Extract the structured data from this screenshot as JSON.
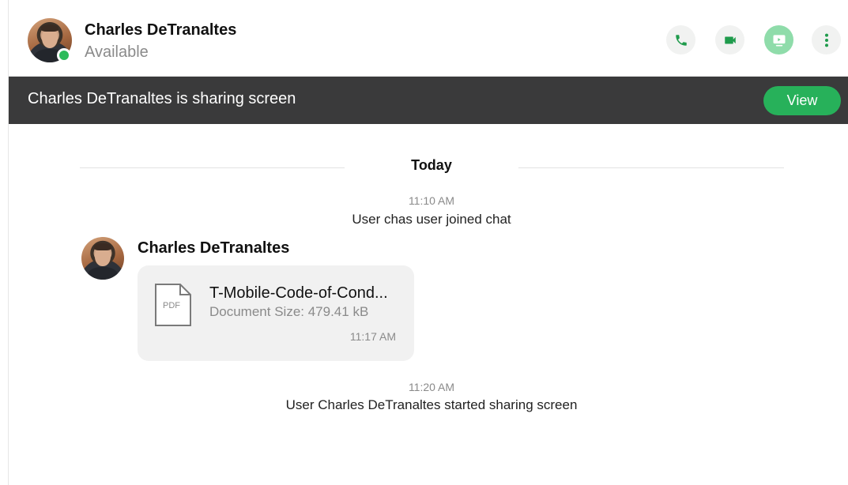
{
  "header": {
    "contact_name": "Charles DeTranaltes",
    "status": "Available",
    "presence_color": "#2dbb5a",
    "actions": [
      {
        "name": "phone-icon",
        "active": false
      },
      {
        "name": "video-icon",
        "active": false
      },
      {
        "name": "screen-share-icon",
        "active": true
      },
      {
        "name": "more-vertical-icon",
        "active": false
      }
    ]
  },
  "banner": {
    "text": "Charles DeTranaltes is sharing screen",
    "view_label": "View",
    "accent": "#27b15a"
  },
  "chat": {
    "date_label": "Today",
    "events": [
      {
        "time": "11:10 AM",
        "text": "User chas user joined chat"
      },
      {
        "time": "11:20 AM",
        "text": "User Charles DeTranaltes started sharing screen"
      }
    ],
    "message": {
      "sender": "Charles DeTranaltes",
      "file": {
        "type_label": "PDF",
        "name": "T-Mobile-Code-of-Cond...",
        "size": "Document Size: 479.41 kB",
        "time": "11:17 AM"
      }
    }
  }
}
